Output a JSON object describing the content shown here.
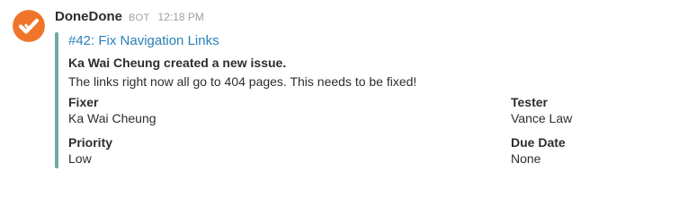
{
  "message": {
    "sender": "DoneDone",
    "badge": "BOT",
    "time": "12:18 PM",
    "avatar_icon": "donedone-check-icon",
    "avatar_color": "#f0752b"
  },
  "attachment": {
    "accent_color": "#6daba0",
    "title": "#42: Fix Navigation Links",
    "pretext": "Ka Wai Cheung created a new issue.",
    "text": "The links right now all go to 404 pages. This needs to be fixed!",
    "fields": [
      {
        "title": "Fixer",
        "value": "Ka Wai Cheung"
      },
      {
        "title": "Tester",
        "value": "Vance Law"
      },
      {
        "title": "Priority",
        "value": "Low"
      },
      {
        "title": "Due Date",
        "value": "None"
      }
    ]
  }
}
